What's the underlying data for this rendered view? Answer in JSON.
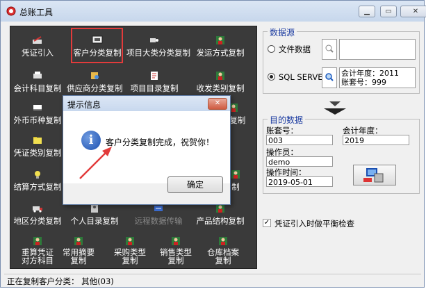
{
  "window": {
    "title": "总账工具",
    "min": "▁",
    "max": "▭",
    "close": "✕"
  },
  "tools": [
    {
      "label": "凭证引入",
      "icon": "pen-icon"
    },
    {
      "label": "客户分类复制",
      "icon": "monitor-icon"
    },
    {
      "label": "项目大类分类复制",
      "icon": "cart-icon"
    },
    {
      "label": "发运方式复制",
      "icon": "person-icon"
    },
    {
      "label": "会计科目复制",
      "icon": "printer-icon"
    },
    {
      "label": "供应商分类复制",
      "icon": "supplier-icon"
    },
    {
      "label": "项目目录复制",
      "icon": "document-icon"
    },
    {
      "label": "收发类别复制",
      "icon": "person-icon"
    },
    {
      "label": "外币币种复制",
      "icon": "currency-icon"
    },
    {
      "label": "型复制",
      "icon": "person-icon"
    },
    {
      "label": "凭证类别复制",
      "icon": "folder-icon"
    },
    {
      "label": "结算方式复制",
      "icon": "bulb-icon"
    },
    {
      "label": "制",
      "icon": "person-icon"
    },
    {
      "label": "地区分类复制",
      "icon": "truck-icon"
    },
    {
      "label": "个人目录复制",
      "icon": "contact-icon"
    },
    {
      "label": "远程数据传输",
      "icon": "transfer-icon"
    },
    {
      "label": "产品结构复制",
      "icon": "person-icon"
    },
    {
      "label": "重算凭证\n对方科目",
      "icon": "person-icon"
    },
    {
      "label": "常用摘要\n复制",
      "icon": "person-icon"
    },
    {
      "label": "采购类型\n复制",
      "icon": "person-icon"
    },
    {
      "label": "销售类型\n复制",
      "icon": "person-icon"
    },
    {
      "label": "仓库档案\n复制",
      "icon": "person-icon"
    }
  ],
  "source": {
    "group_title": "数据源",
    "file_label": "文件数据",
    "sql_label": "SQL SERVER",
    "sql_info_line1": "会计年度：2011",
    "sql_info_line2": "账套号：999"
  },
  "target": {
    "group_title": "目的数据",
    "account_label": "账套号：",
    "account_value": "003",
    "year_label": "会计年度：",
    "year_value": "2019",
    "operator_label": "操作员：",
    "operator_value": "demo",
    "time_label": "操作时间：",
    "time_value": "2019-05-01"
  },
  "checkbox": {
    "label": "凭证引入时做平衡检查",
    "mark": "✓"
  },
  "dialog": {
    "title": "提示信息",
    "message": "客户分类复制完成，祝贺你！",
    "ok": "确定",
    "close": "✕",
    "info": "i"
  },
  "status": {
    "text": "正在复制客户分类：  其他(03)"
  }
}
